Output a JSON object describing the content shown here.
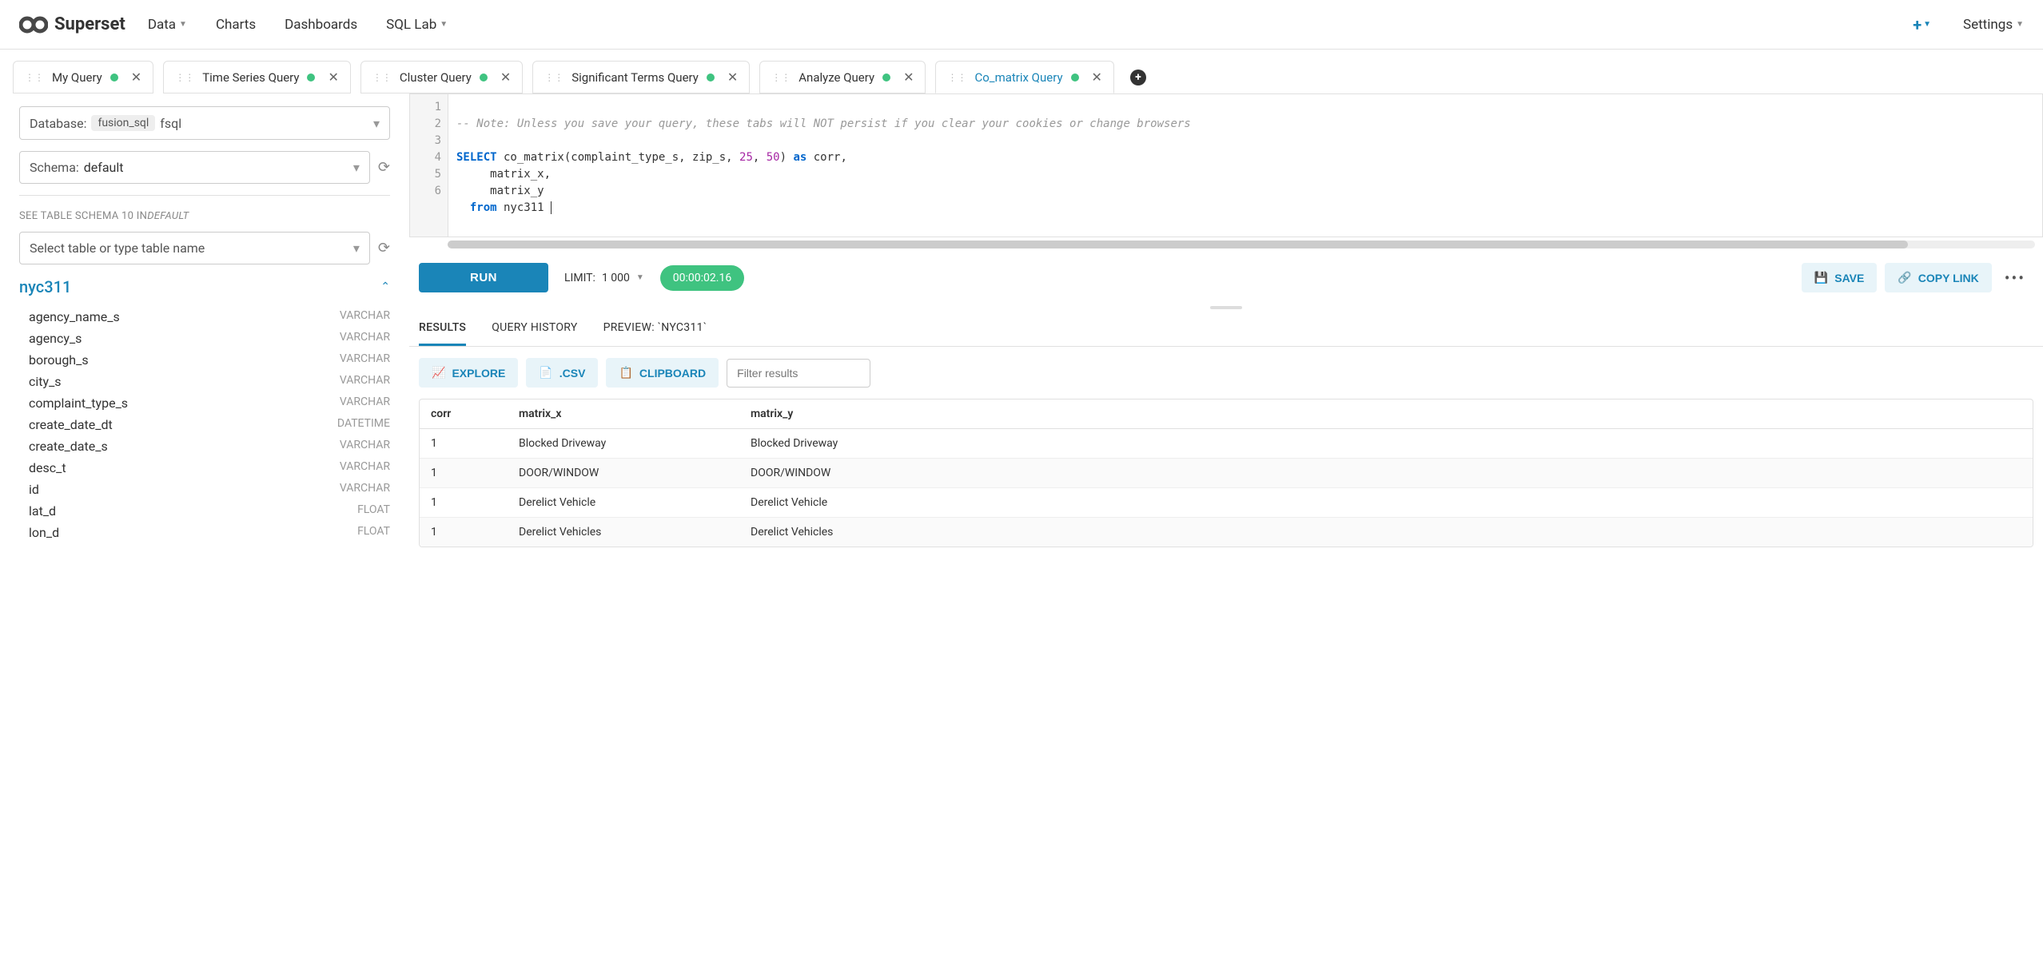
{
  "brand": "Superset",
  "nav": {
    "data": "Data",
    "charts": "Charts",
    "dashboards": "Dashboards",
    "sqllab": "SQL Lab",
    "settings": "Settings"
  },
  "tabs": [
    {
      "label": "My Query"
    },
    {
      "label": "Time Series Query"
    },
    {
      "label": "Cluster Query"
    },
    {
      "label": "Significant Terms Query"
    },
    {
      "label": "Analyze Query"
    },
    {
      "label": "Co_matrix Query"
    }
  ],
  "sidebar": {
    "database_label": "Database:",
    "database_chip": "fusion_sql",
    "database_value": "fsql",
    "schema_label": "Schema:",
    "schema_value": "default",
    "section": {
      "prefix": "SEE TABLE SCHEMA",
      "count": "10 IN",
      "suffix": "DEFAULT"
    },
    "table_placeholder": "Select table or type table name",
    "table_name": "nyc311",
    "columns": [
      {
        "name": "agency_name_s",
        "type": "VARCHAR"
      },
      {
        "name": "agency_s",
        "type": "VARCHAR"
      },
      {
        "name": "borough_s",
        "type": "VARCHAR"
      },
      {
        "name": "city_s",
        "type": "VARCHAR"
      },
      {
        "name": "complaint_type_s",
        "type": "VARCHAR"
      },
      {
        "name": "create_date_dt",
        "type": "DATETIME"
      },
      {
        "name": "create_date_s",
        "type": "VARCHAR"
      },
      {
        "name": "desc_t",
        "type": "VARCHAR"
      },
      {
        "name": "id",
        "type": "VARCHAR"
      },
      {
        "name": "lat_d",
        "type": "FLOAT"
      },
      {
        "name": "lon_d",
        "type": "FLOAT"
      }
    ]
  },
  "editor": {
    "line_count": 6,
    "comment": "-- Note: Unless you save your query, these tabs will NOT persist if you clear your cookies or change browsers",
    "l3": {
      "kw": "SELECT",
      "rest1": " co_matrix(complaint_type_s, zip_s, ",
      "n1": "25",
      "c1": ", ",
      "n2": "50",
      "rest2": ") ",
      "kw2": "as",
      "rest3": " corr,"
    },
    "l4": "     matrix_x,",
    "l5": "     matrix_y",
    "l6": {
      "kw": "from",
      "rest": " nyc311"
    }
  },
  "runbar": {
    "run": "RUN",
    "limit_label": "LIMIT:",
    "limit_value": "1 000",
    "timer": "00:00:02.16",
    "save": "SAVE",
    "copy": "COPY LINK"
  },
  "result_tabs": {
    "results": "RESULTS",
    "history": "QUERY HISTORY",
    "preview": "PREVIEW: `NYC311`"
  },
  "result_toolbar": {
    "explore": "EXPLORE",
    "csv": ".CSV",
    "clipboard": "CLIPBOARD",
    "filter_placeholder": "Filter results"
  },
  "results": {
    "headers": [
      "corr",
      "matrix_x",
      "matrix_y"
    ],
    "rows": [
      [
        "1",
        "Blocked Driveway",
        "Blocked Driveway"
      ],
      [
        "1",
        "DOOR/WINDOW",
        "DOOR/WINDOW"
      ],
      [
        "1",
        "Derelict Vehicle",
        "Derelict Vehicle"
      ],
      [
        "1",
        "Derelict Vehicles",
        "Derelict Vehicles"
      ]
    ]
  }
}
